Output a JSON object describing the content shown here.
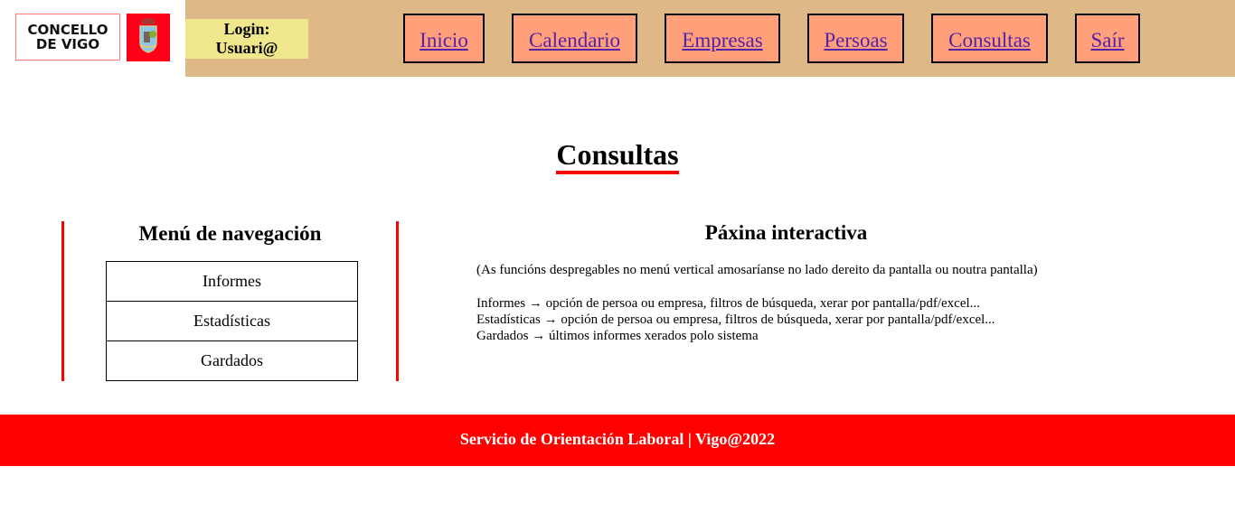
{
  "header": {
    "logo_text": "CONCELLO DE VIGO",
    "login_label": "Login:",
    "login_user": "Usuari@",
    "nav": [
      {
        "label": "Inicio"
      },
      {
        "label": "Calendario"
      },
      {
        "label": "Empresas"
      },
      {
        "label": "Persoas"
      },
      {
        "label": "Consultas"
      },
      {
        "label": "Saír"
      }
    ]
  },
  "page_title": "Consultas",
  "sidebar": {
    "title": "Menú de navegación",
    "items": [
      {
        "label": "Informes"
      },
      {
        "label": "Estadísticas"
      },
      {
        "label": "Gardados"
      }
    ]
  },
  "main": {
    "title": "Páxina interactiva",
    "note": "(As funcións despregables no menú vertical amosaríanse no lado dereito da pantalla ou noutra pantalla)",
    "lines": [
      "Informes → opción de persoa ou empresa, filtros de búsqueda, xerar por pantalla/pdf/excel...",
      "Estadísticas → opción de persoa ou empresa, filtros de búsqueda, xerar por pantalla/pdf/excel...",
      "Gardados → últimos informes xerados polo sistema"
    ]
  },
  "footer": "Servicio de Orientación Laboral | Vigo@2022",
  "colors": {
    "header_bg": "#deb887",
    "nav_bg": "#ffa07a",
    "login_bg": "#f0e68c",
    "accent": "#ff0000"
  }
}
